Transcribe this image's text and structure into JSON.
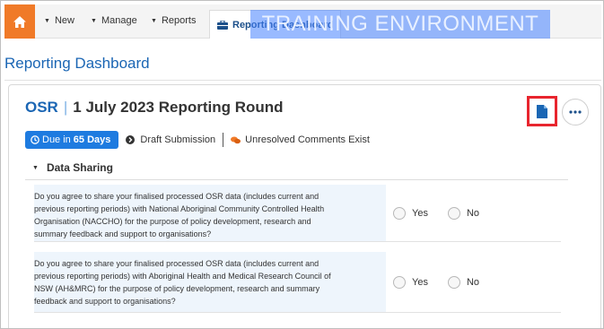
{
  "nav": {
    "new_label": "New",
    "manage_label": "Manage",
    "reports_label": "Reports",
    "dashboard_tab_label": "Reporting Dashboard",
    "training_banner": "TRAINING ENVIRONMENT"
  },
  "page": {
    "title": "Reporting Dashboard"
  },
  "round": {
    "code": "OSR",
    "title": "1 July 2023 Reporting Round",
    "due_prefix": "Due in",
    "due_value": "65 Days",
    "draft_label": "Draft Submission",
    "comments_label": "Unresolved Comments Exist"
  },
  "section": {
    "title": "Data Sharing",
    "questions": [
      {
        "lines": [
          "Do you agree to share your finalised processed OSR data (includes current and",
          "previous reporting periods) with National Aboriginal Community Controlled Health",
          "Organisation (NACCHO) for the purpose of policy development, research and",
          "summary feedback and support to organisations?"
        ],
        "yes": "Yes",
        "no": "No"
      },
      {
        "lines": [
          "Do you agree to share your finalised processed OSR data (includes current and",
          "previous reporting periods) with Aboriginal Health and Medical Research Council of",
          "NSW (AH&MRC) for the purpose of policy development, research and summary",
          "feedback and support to organisations?"
        ],
        "yes": "Yes",
        "no": "No"
      }
    ]
  },
  "colors": {
    "home": "#f07a28",
    "accent": "#1b66b4",
    "due_badge": "#1e7be0",
    "highlight_box": "#e8252e",
    "comment_icon": "#f07a28"
  },
  "icons": {
    "home": "home-icon",
    "dashboard": "briefcase-icon",
    "document": "document-icon",
    "more": "ellipsis-icon",
    "clock": "clock-icon",
    "draft": "arrow-circle-icon",
    "comments": "comments-icon"
  }
}
